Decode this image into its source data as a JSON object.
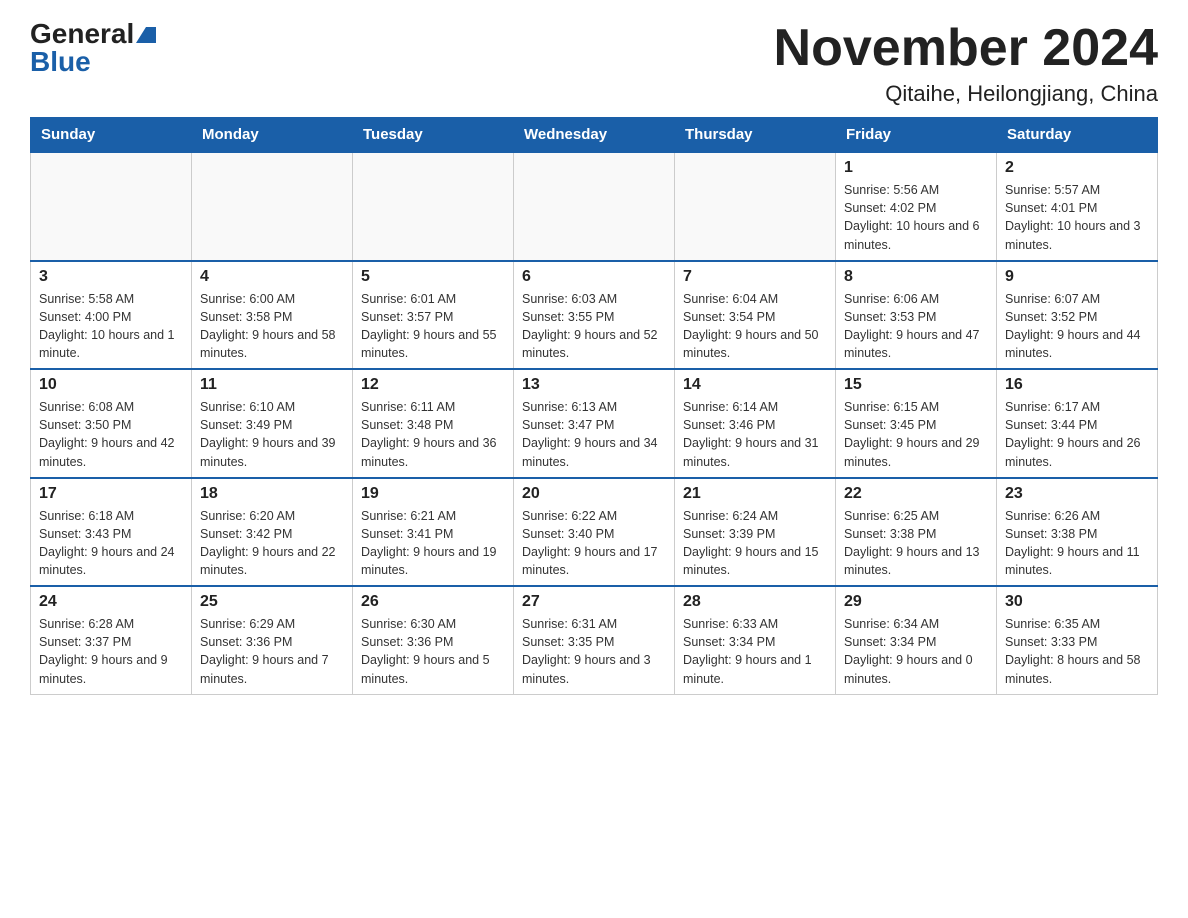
{
  "header": {
    "logo_general": "General",
    "logo_blue": "Blue",
    "month_title": "November 2024",
    "location": "Qitaihe, Heilongjiang, China"
  },
  "weekdays": [
    "Sunday",
    "Monday",
    "Tuesday",
    "Wednesday",
    "Thursday",
    "Friday",
    "Saturday"
  ],
  "rows": [
    [
      {
        "day": "",
        "info": ""
      },
      {
        "day": "",
        "info": ""
      },
      {
        "day": "",
        "info": ""
      },
      {
        "day": "",
        "info": ""
      },
      {
        "day": "",
        "info": ""
      },
      {
        "day": "1",
        "info": "Sunrise: 5:56 AM\nSunset: 4:02 PM\nDaylight: 10 hours and 6 minutes."
      },
      {
        "day": "2",
        "info": "Sunrise: 5:57 AM\nSunset: 4:01 PM\nDaylight: 10 hours and 3 minutes."
      }
    ],
    [
      {
        "day": "3",
        "info": "Sunrise: 5:58 AM\nSunset: 4:00 PM\nDaylight: 10 hours and 1 minute."
      },
      {
        "day": "4",
        "info": "Sunrise: 6:00 AM\nSunset: 3:58 PM\nDaylight: 9 hours and 58 minutes."
      },
      {
        "day": "5",
        "info": "Sunrise: 6:01 AM\nSunset: 3:57 PM\nDaylight: 9 hours and 55 minutes."
      },
      {
        "day": "6",
        "info": "Sunrise: 6:03 AM\nSunset: 3:55 PM\nDaylight: 9 hours and 52 minutes."
      },
      {
        "day": "7",
        "info": "Sunrise: 6:04 AM\nSunset: 3:54 PM\nDaylight: 9 hours and 50 minutes."
      },
      {
        "day": "8",
        "info": "Sunrise: 6:06 AM\nSunset: 3:53 PM\nDaylight: 9 hours and 47 minutes."
      },
      {
        "day": "9",
        "info": "Sunrise: 6:07 AM\nSunset: 3:52 PM\nDaylight: 9 hours and 44 minutes."
      }
    ],
    [
      {
        "day": "10",
        "info": "Sunrise: 6:08 AM\nSunset: 3:50 PM\nDaylight: 9 hours and 42 minutes."
      },
      {
        "day": "11",
        "info": "Sunrise: 6:10 AM\nSunset: 3:49 PM\nDaylight: 9 hours and 39 minutes."
      },
      {
        "day": "12",
        "info": "Sunrise: 6:11 AM\nSunset: 3:48 PM\nDaylight: 9 hours and 36 minutes."
      },
      {
        "day": "13",
        "info": "Sunrise: 6:13 AM\nSunset: 3:47 PM\nDaylight: 9 hours and 34 minutes."
      },
      {
        "day": "14",
        "info": "Sunrise: 6:14 AM\nSunset: 3:46 PM\nDaylight: 9 hours and 31 minutes."
      },
      {
        "day": "15",
        "info": "Sunrise: 6:15 AM\nSunset: 3:45 PM\nDaylight: 9 hours and 29 minutes."
      },
      {
        "day": "16",
        "info": "Sunrise: 6:17 AM\nSunset: 3:44 PM\nDaylight: 9 hours and 26 minutes."
      }
    ],
    [
      {
        "day": "17",
        "info": "Sunrise: 6:18 AM\nSunset: 3:43 PM\nDaylight: 9 hours and 24 minutes."
      },
      {
        "day": "18",
        "info": "Sunrise: 6:20 AM\nSunset: 3:42 PM\nDaylight: 9 hours and 22 minutes."
      },
      {
        "day": "19",
        "info": "Sunrise: 6:21 AM\nSunset: 3:41 PM\nDaylight: 9 hours and 19 minutes."
      },
      {
        "day": "20",
        "info": "Sunrise: 6:22 AM\nSunset: 3:40 PM\nDaylight: 9 hours and 17 minutes."
      },
      {
        "day": "21",
        "info": "Sunrise: 6:24 AM\nSunset: 3:39 PM\nDaylight: 9 hours and 15 minutes."
      },
      {
        "day": "22",
        "info": "Sunrise: 6:25 AM\nSunset: 3:38 PM\nDaylight: 9 hours and 13 minutes."
      },
      {
        "day": "23",
        "info": "Sunrise: 6:26 AM\nSunset: 3:38 PM\nDaylight: 9 hours and 11 minutes."
      }
    ],
    [
      {
        "day": "24",
        "info": "Sunrise: 6:28 AM\nSunset: 3:37 PM\nDaylight: 9 hours and 9 minutes."
      },
      {
        "day": "25",
        "info": "Sunrise: 6:29 AM\nSunset: 3:36 PM\nDaylight: 9 hours and 7 minutes."
      },
      {
        "day": "26",
        "info": "Sunrise: 6:30 AM\nSunset: 3:36 PM\nDaylight: 9 hours and 5 minutes."
      },
      {
        "day": "27",
        "info": "Sunrise: 6:31 AM\nSunset: 3:35 PM\nDaylight: 9 hours and 3 minutes."
      },
      {
        "day": "28",
        "info": "Sunrise: 6:33 AM\nSunset: 3:34 PM\nDaylight: 9 hours and 1 minute."
      },
      {
        "day": "29",
        "info": "Sunrise: 6:34 AM\nSunset: 3:34 PM\nDaylight: 9 hours and 0 minutes."
      },
      {
        "day": "30",
        "info": "Sunrise: 6:35 AM\nSunset: 3:33 PM\nDaylight: 8 hours and 58 minutes."
      }
    ]
  ]
}
